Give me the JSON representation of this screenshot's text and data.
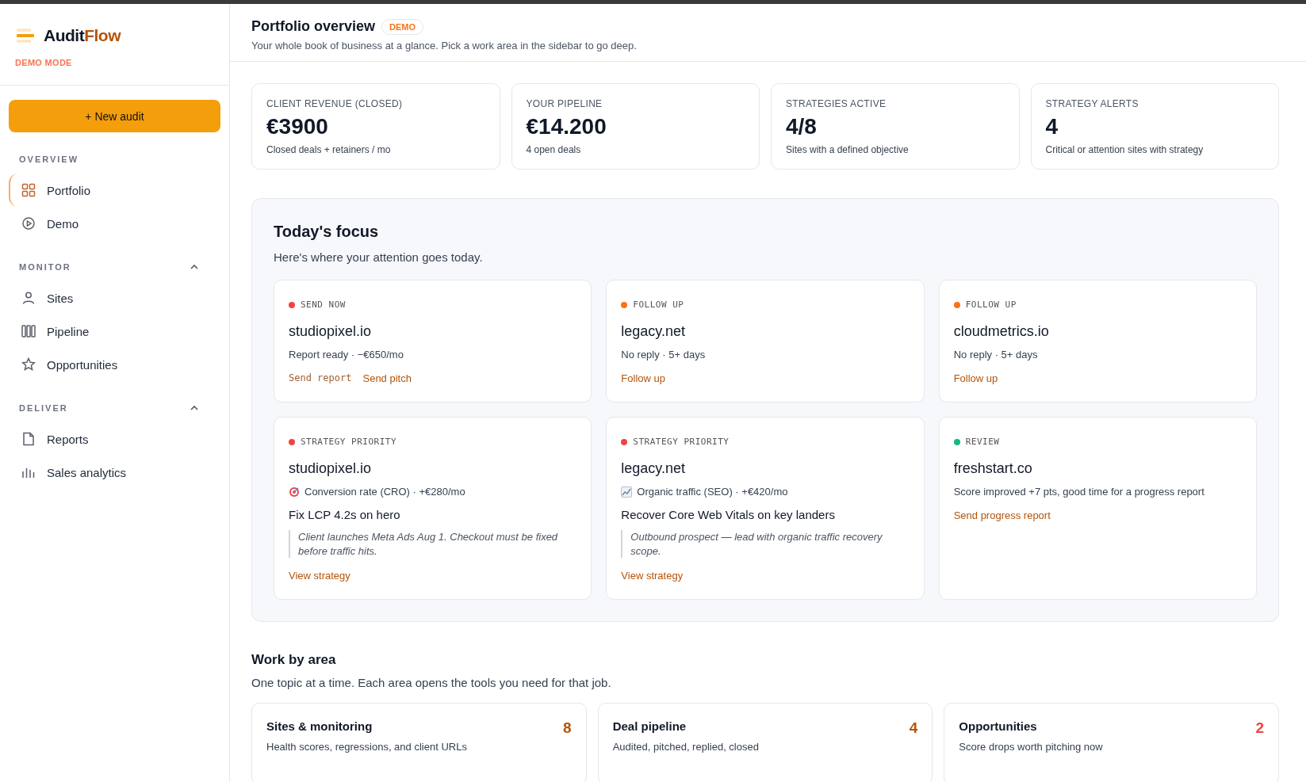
{
  "brand": {
    "name_start": "Audit",
    "name_end": "Flow",
    "mode": "DEMO MODE"
  },
  "new_button": "+ New audit",
  "nav": [
    {
      "title": "OVERVIEW",
      "items": [
        {
          "label": "Portfolio",
          "selected": true
        },
        {
          "label": "Demo",
          "selected": false
        }
      ]
    },
    {
      "title": "MONITOR",
      "items": [
        {
          "label": "Sites",
          "selected": false
        },
        {
          "label": "Pipeline",
          "selected": false
        },
        {
          "label": "Opportunities",
          "selected": false
        }
      ]
    },
    {
      "title": "DELIVER",
      "items": [
        {
          "label": "Reports",
          "selected": false
        },
        {
          "label": "Sales analytics",
          "selected": false
        }
      ]
    }
  ],
  "header": {
    "title": "Portfolio overview",
    "badge": "DEMO",
    "subtitle": "Your whole book of business at a glance. Pick a work area in the sidebar to go deep."
  },
  "stats": [
    {
      "label": "CLIENT REVENUE (CLOSED)",
      "value": "€3900",
      "note": "Closed deals + retainers / mo"
    },
    {
      "label": "YOUR PIPELINE",
      "value": "€14.200",
      "note": "4 open deals"
    },
    {
      "label": "STRATEGIES ACTIVE",
      "value": "4/8",
      "note": "Sites with a defined objective"
    },
    {
      "label": "STRATEGY ALERTS",
      "value": "4",
      "note": "Critical or attention sites with strategy"
    }
  ],
  "focus": {
    "title": "Today's focus",
    "subtitle": "Here's where your attention goes today.",
    "cards": [
      {
        "tag": "SEND NOW",
        "color": "#ef4444",
        "site": "studiopixel.io",
        "meta": "Report ready · −€650/mo",
        "actions": [
          {
            "label": "Send report",
            "kind": "mono"
          },
          {
            "label": "Send pitch",
            "kind": "link"
          }
        ]
      },
      {
        "tag": "FOLLOW UP",
        "color": "#f97316",
        "site": "legacy.net",
        "meta": "No reply · 5+ days",
        "actions": [
          {
            "label": "Follow up",
            "kind": "link"
          }
        ]
      },
      {
        "tag": "FOLLOW UP",
        "color": "#f97316",
        "site": "cloudmetrics.io",
        "meta": "No reply · 5+ days",
        "actions": [
          {
            "label": "Follow up",
            "kind": "link"
          }
        ]
      },
      {
        "tag": "STRATEGY PRIORITY",
        "color": "#ef4444",
        "site": "studiopixel.io",
        "meta": "Conversion rate (CRO) · +€280/mo",
        "task": "Fix LCP 4.2s on hero",
        "note": "Client launches Meta Ads Aug 1. Checkout must be fixed before traffic hits.",
        "actions": [
          {
            "label": "View strategy",
            "kind": "link"
          }
        ]
      },
      {
        "tag": "STRATEGY PRIORITY",
        "color": "#ef4444",
        "site": "legacy.net",
        "meta": "Organic traffic (SEO) · +€420/mo",
        "task": "Recover Core Web Vitals on key landers",
        "note": "Outbound prospect — lead with organic traffic recovery scope.",
        "actions": [
          {
            "label": "View strategy",
            "kind": "link"
          }
        ]
      },
      {
        "tag": "REVIEW",
        "color": "#10b981",
        "site": "freshstart.co",
        "meta": "Score improved +7 pts, good time for a progress report",
        "actions": [
          {
            "label": "Send progress report",
            "kind": "link"
          }
        ]
      }
    ]
  },
  "areas": {
    "title": "Work by area",
    "subtitle": "One topic at a time. Each area opens the tools you need for that job.",
    "cards": [
      {
        "title": "Sites & monitoring",
        "count": "8",
        "color": "#b45309",
        "description": "Health scores, regressions, and client URLs"
      },
      {
        "title": "Deal pipeline",
        "count": "4",
        "color": "#b45309",
        "description": "Audited, pitched, replied, closed"
      },
      {
        "title": "Opportunities",
        "count": "2",
        "color": "#ef4444",
        "description": "Score drops worth pitching now"
      }
    ]
  }
}
